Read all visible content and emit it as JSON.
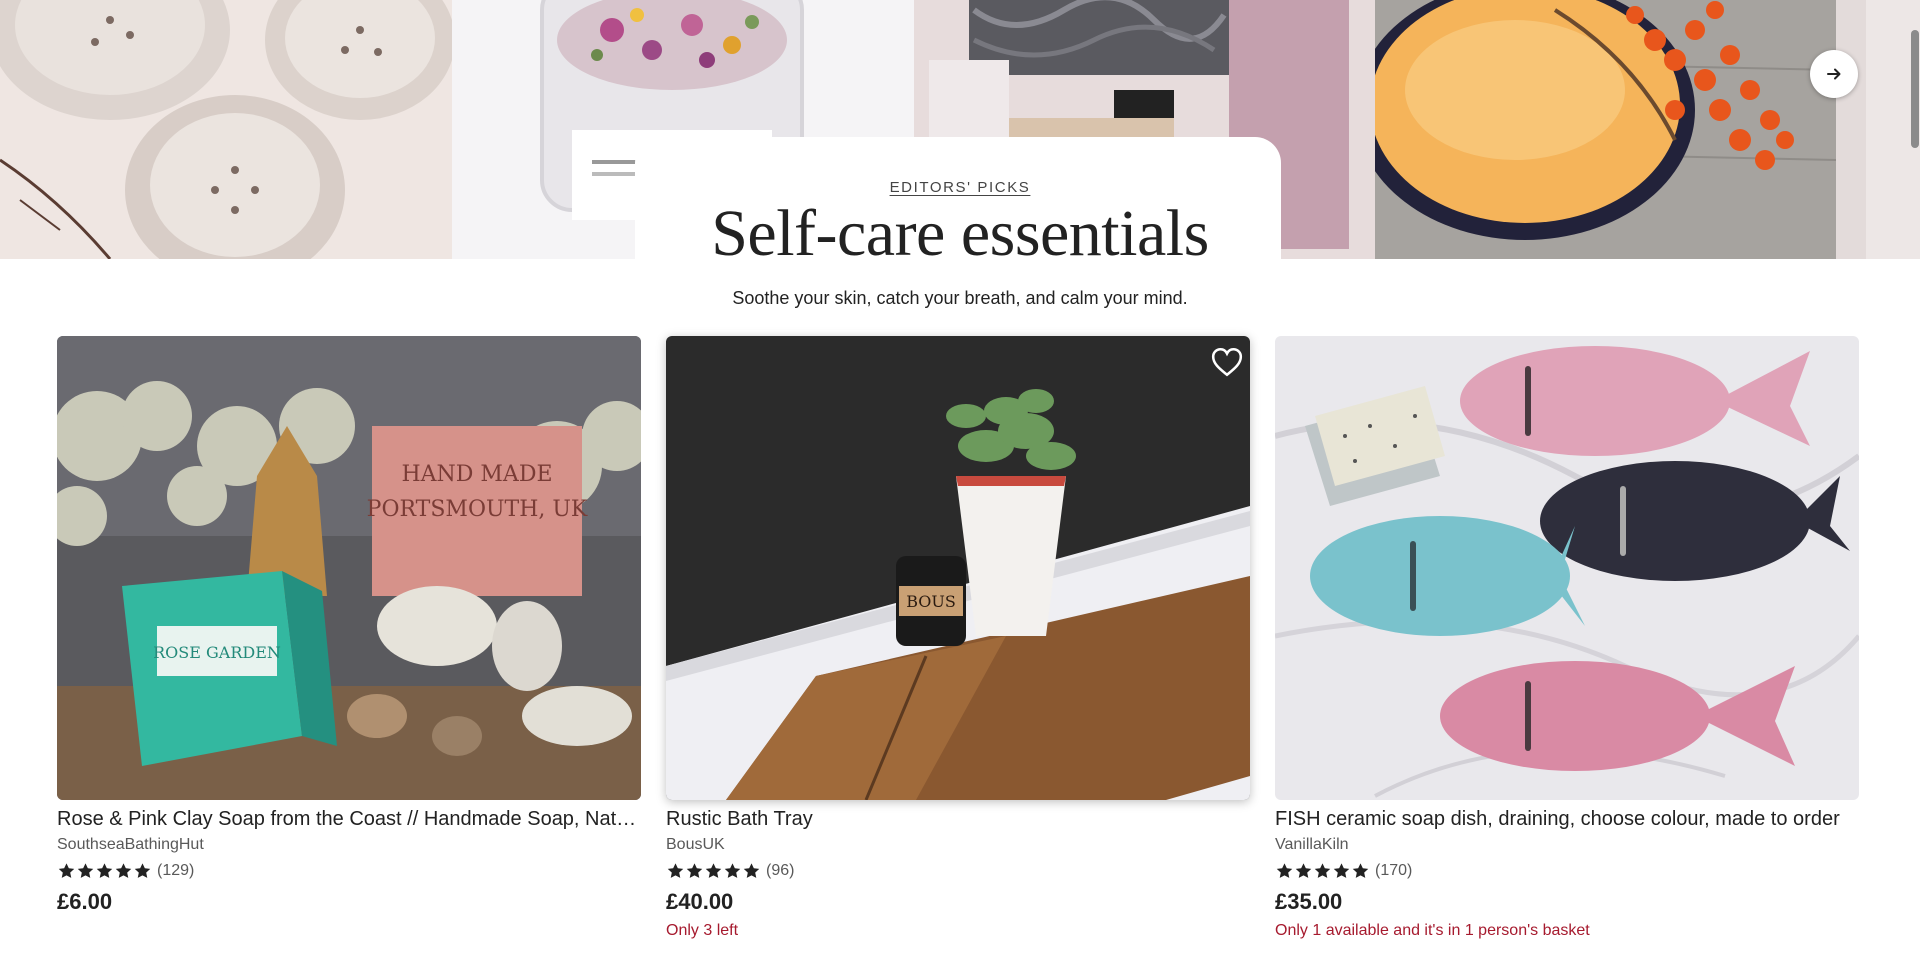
{
  "hero": {
    "next_label": "arrow-right-icon"
  },
  "editors": {
    "eyebrow": "EDITORS' PICKS",
    "title": "Self-care essentials",
    "subtitle": "Soothe your skin, catch your breath, and calm your mind."
  },
  "listings": [
    {
      "title": "Rose & Pink Clay Soap from the Coast // Handmade Soap, Natural Vegan Soap",
      "shop": "SouthseaBathingHut",
      "rating": 5,
      "reviews": "(129)",
      "price": "£6.00",
      "stock": ""
    },
    {
      "title": "Rustic Bath Tray",
      "shop": "BousUK",
      "rating": 5,
      "reviews": "(96)",
      "price": "£40.00",
      "stock": "Only 3 left"
    },
    {
      "title": "FISH ceramic soap dish, draining, choose colour, made to order",
      "shop": "VanillaKiln",
      "rating": 5,
      "reviews": "(170)",
      "price": "£35.00",
      "stock": "Only 1 available and it's in 1 person's basket"
    }
  ],
  "colors": {
    "stock_warning": "#a61a2e",
    "text": "#222222",
    "muted": "#595959"
  }
}
